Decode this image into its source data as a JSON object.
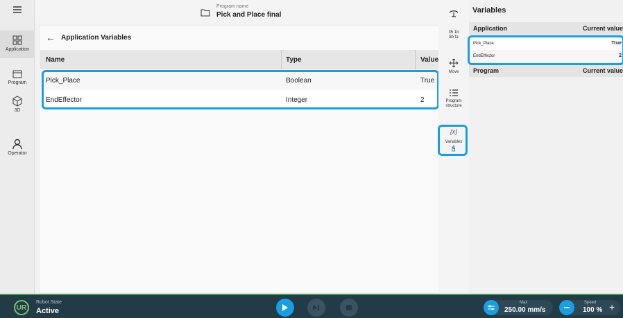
{
  "header": {
    "program_caption": "Program name",
    "program_name": "Pick and Place final"
  },
  "nav": [
    {
      "label": "Application",
      "icon": "application-icon"
    },
    {
      "label": "Program",
      "icon": "program-icon"
    },
    {
      "label": "3D",
      "icon": "cube-icon"
    },
    {
      "label": "Operator",
      "icon": "operator-icon"
    }
  ],
  "content": {
    "title": "Application Variables",
    "columns": [
      "Name",
      "Type",
      "Value"
    ],
    "rows": [
      {
        "name": "Pick_Place",
        "type": "Boolean",
        "value": "True"
      },
      {
        "name": "EndEffector",
        "type": "Integer",
        "value": "2"
      }
    ]
  },
  "rail": {
    "misc_line1": "35 1b",
    "misc_line2": "8b fa",
    "move_label": "Move",
    "structure_line1": "Program",
    "structure_line2": "structure",
    "variables_symbol": "{x}",
    "variables_label": "Variables"
  },
  "variables_panel": {
    "title": "Variables",
    "application_header": "Application",
    "current_value_header": "Current value",
    "items": [
      {
        "name": "Pick_Place",
        "value": "True"
      },
      {
        "name": "EndEffector",
        "value": "2"
      }
    ],
    "program_header": "Program",
    "program_current_value_header": "Current value"
  },
  "status": {
    "logo_text": "UR",
    "robot_state_caption": "Robot State",
    "robot_state": "Active",
    "max_caption": "Max",
    "max_value": "250.00 mm/s",
    "speed_caption": "Speed",
    "speed_value": "100 %",
    "plus_symbol": "+"
  },
  "colors": {
    "accent": "#1a9ee0",
    "status_bar": "#233a47",
    "active_green": "#39a945"
  }
}
